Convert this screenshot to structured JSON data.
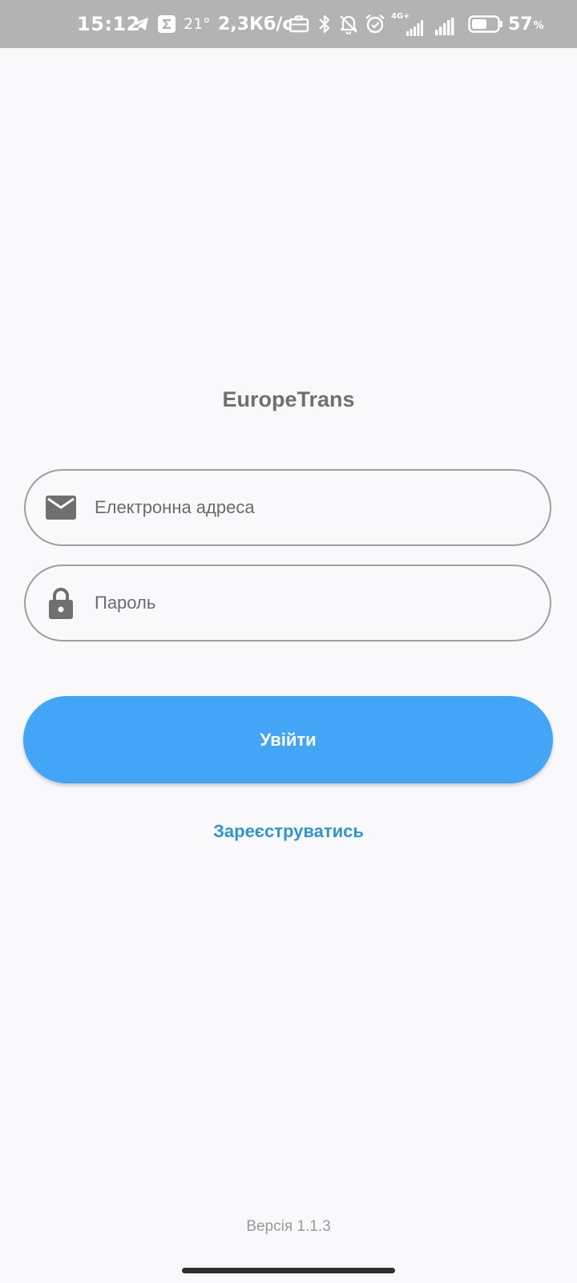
{
  "status_bar": {
    "time": "15:12",
    "temperature": "21°",
    "network_speed": "2,3Кб/с",
    "network_type": "4G+",
    "battery_percent": "57",
    "battery_unit": "%",
    "battery_level": 0.57,
    "icons": [
      "telegram-icon",
      "sigma-icon",
      "briefcase-icon",
      "bluetooth-icon",
      "bell-off-icon",
      "alarm-icon",
      "signal-icon",
      "signal-icon",
      "battery-icon"
    ]
  },
  "app": {
    "title": "EuropeTrans"
  },
  "form": {
    "email": {
      "placeholder": "Електронна адреса",
      "value": "",
      "icon": "mail-icon"
    },
    "password": {
      "placeholder": "Пароль",
      "value": "",
      "icon": "lock-icon"
    },
    "login_label": "Увійти",
    "register_label": "Зареєструватись"
  },
  "footer": {
    "version": "Версія 1.1.3"
  },
  "colors": {
    "accent": "#42a5f5",
    "link": "#2f95d8",
    "status_bar": "#b3b3b3",
    "background": "#f9f9fb",
    "field_border": "#9e9e9e",
    "icon": "#6f6f6f"
  }
}
